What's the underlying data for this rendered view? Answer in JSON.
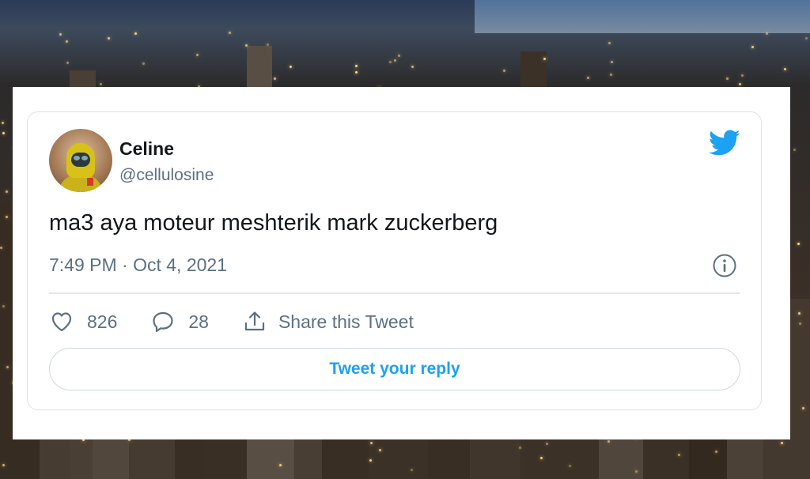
{
  "tweet": {
    "author_name": "Celine",
    "author_handle": "@cellulosine",
    "text": "ma3 aya moteur meshterik mark zuckerberg",
    "timestamp": "7:49 PM · Oct 4, 2021",
    "likes": "826",
    "replies": "28",
    "share_label": "Share this Tweet",
    "reply_button_label": "Tweet your reply"
  },
  "icons": {
    "brand": "twitter-bird-icon",
    "info": "info-icon",
    "like": "heart-icon",
    "reply": "comment-icon",
    "share": "share-icon"
  },
  "colors": {
    "brand_blue": "#1da1f2",
    "text_primary": "#14171a",
    "text_secondary": "#5b7083"
  }
}
